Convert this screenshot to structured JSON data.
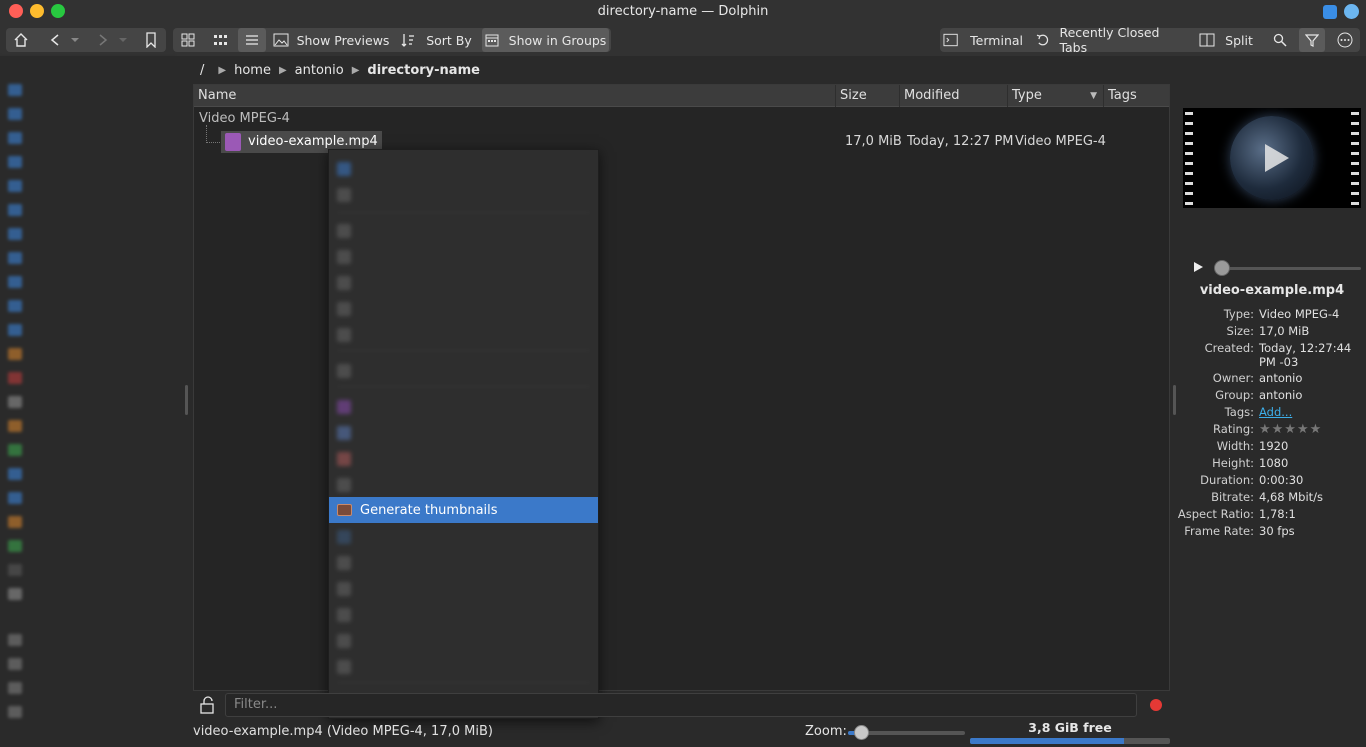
{
  "window": {
    "title": "directory-name — Dolphin"
  },
  "toolbar": {
    "show_previews": "Show Previews",
    "sort_by": "Sort By",
    "show_in_groups": "Show in Groups",
    "terminal": "Terminal",
    "recently_closed_tabs": "Recently Closed Tabs",
    "split": "Split"
  },
  "breadcrumb": {
    "root": "/",
    "items": [
      "home",
      "antonio",
      "directory-name"
    ]
  },
  "columns": [
    "Name",
    "Size",
    "Modified",
    "Type",
    "Tags"
  ],
  "group": {
    "label": "Video MPEG-4"
  },
  "file": {
    "name": "video-example.mp4",
    "size": "17,0 MiB",
    "modified": "Today, 12:27 PM",
    "type": "Video MPEG-4"
  },
  "context_menu": {
    "highlighted": "Generate thumbnails"
  },
  "filter": {
    "placeholder": "Filter..."
  },
  "status": {
    "text": "video-example.mp4 (Video MPEG-4, 17,0 MiB)",
    "zoom_label": "Zoom:",
    "zoom_level": 0.1,
    "free_space": "3,8 GiB free",
    "used_fraction": 0.77
  },
  "info_panel": {
    "title": "video-example.mp4",
    "properties": [
      {
        "key": "Type:",
        "value": "Video MPEG-4"
      },
      {
        "key": "Size:",
        "value": "17,0 MiB"
      },
      {
        "key": "Created:",
        "value": "Today, 12:27:44 PM -03"
      },
      {
        "key": "Owner:",
        "value": "antonio"
      },
      {
        "key": "Group:",
        "value": "antonio"
      },
      {
        "key": "Tags:",
        "value": "Add..."
      },
      {
        "key": "Rating:",
        "value": "★★★★★"
      },
      {
        "key": "Width:",
        "value": "1920"
      },
      {
        "key": "Height:",
        "value": "1080"
      },
      {
        "key": "Duration:",
        "value": "0:00:30"
      },
      {
        "key": "Bitrate:",
        "value": "4,68 Mbit/s"
      },
      {
        "key": "Aspect Ratio:",
        "value": "1,78:1"
      },
      {
        "key": "Frame Rate:",
        "value": "30 fps"
      }
    ]
  },
  "colors": {
    "accent": "#3b79c9",
    "window_bg": "#2a2a2a",
    "link": "#3daee9"
  }
}
